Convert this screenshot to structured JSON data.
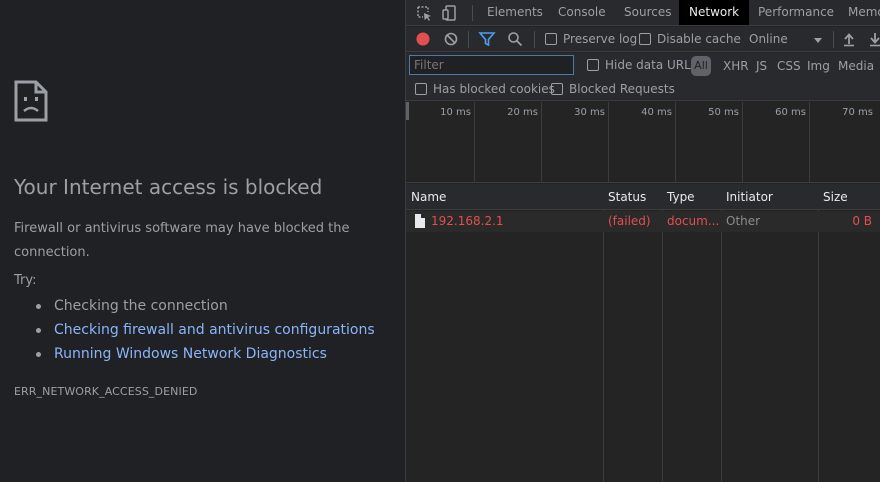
{
  "error_page": {
    "title": "Your Internet access is blocked",
    "description": "Firewall or antivirus software may have blocked the connection.",
    "try_label": "Try:",
    "suggestions": [
      {
        "text": "Checking the connection",
        "link": false
      },
      {
        "text": "Checking firewall and antivirus configurations",
        "link": true
      },
      {
        "text": "Running Windows Network Diagnostics",
        "link": true
      }
    ],
    "error_code": "ERR_NETWORK_ACCESS_DENIED"
  },
  "devtools": {
    "tabs": [
      "Elements",
      "Console",
      "Sources",
      "Network",
      "Performance",
      "Memo"
    ],
    "active_tab": "Network",
    "toolbar": {
      "preserve_log": "Preserve log",
      "disable_cache": "Disable cache",
      "throttling": "Online"
    },
    "filter": {
      "placeholder": "Filter",
      "hide_data_urls": "Hide data URLs",
      "all": "All",
      "types": [
        "XHR",
        "JS",
        "CSS",
        "Img",
        "Media"
      ],
      "has_blocked_cookies": "Has blocked cookies",
      "blocked_requests": "Blocked Requests"
    },
    "timeline_ticks": [
      "10 ms",
      "20 ms",
      "30 ms",
      "40 ms",
      "50 ms",
      "60 ms",
      "70 ms"
    ],
    "columns": [
      "Name",
      "Status",
      "Type",
      "Initiator",
      "Size"
    ],
    "rows": [
      {
        "name": "192.168.2.1",
        "status": "(failed)",
        "type": "docum...",
        "initiator": "Other",
        "size": "0 B"
      }
    ]
  },
  "colors": {
    "page_bg": "#202124",
    "link": "#8ab4f8",
    "error_red": "#e34f4f",
    "record_red": "#e34f4f",
    "filter_blue": "#4d79a8"
  }
}
